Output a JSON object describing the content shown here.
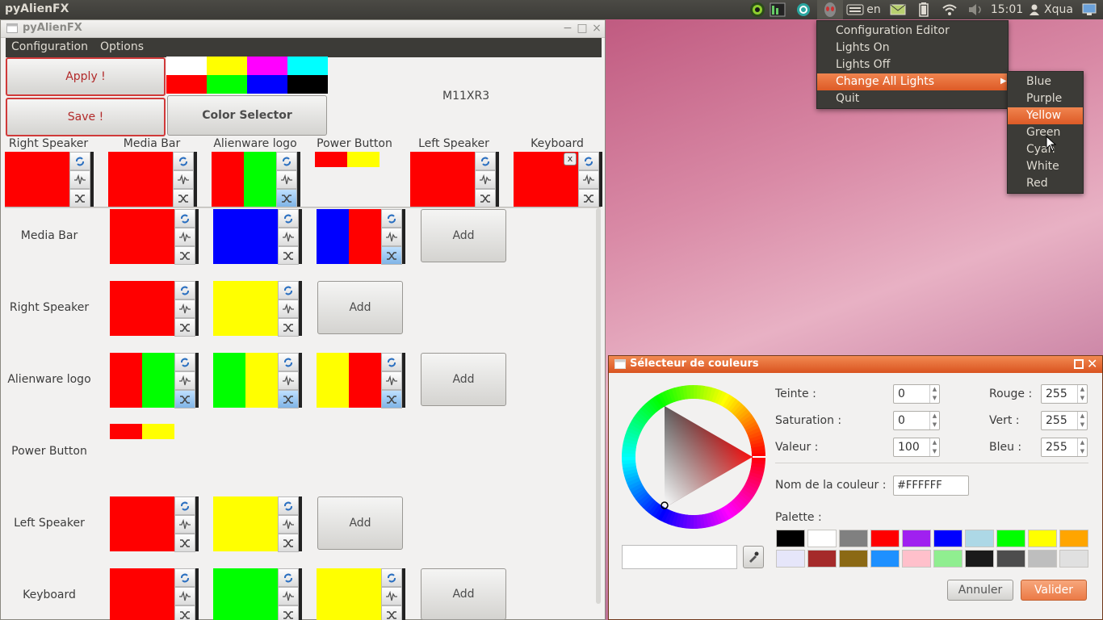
{
  "panel": {
    "app_name": "pyAlienFX",
    "lang": "en",
    "clock": "15:01",
    "user": "Xqua"
  },
  "main_window": {
    "title": "pyAlienFX",
    "menu": [
      "Configuration",
      "Options"
    ],
    "apply_label": "Apply !",
    "save_label": "Save !",
    "color_selector_label": "Color Selector",
    "model": "M11XR3",
    "quick_colors_top": [
      "#ffffff",
      "#ffff00",
      "#ff00ff",
      "#00ffff"
    ],
    "quick_colors_bottom": [
      "#ff0000",
      "#00ff00",
      "#0000ff",
      "#000000"
    ],
    "zone_headers": [
      "Right Speaker",
      "Media Bar",
      "Alienware logo",
      "Power Button",
      "Left Speaker",
      "Keyboard"
    ],
    "row_labels": [
      "Media Bar",
      "Right Speaker",
      "Alienware logo",
      "Power Button",
      "Left Speaker",
      "Keyboard"
    ],
    "add_label": "Add",
    "close_x": "x"
  },
  "tray_menu": {
    "items": [
      "Configuration Editor",
      "Lights On",
      "Lights Off",
      "Change All Lights",
      "Quit"
    ],
    "active_index": 3
  },
  "submenu": {
    "items": [
      "Blue",
      "Purple",
      "Yellow",
      "Green",
      "Cyan",
      "White",
      "Red"
    ],
    "active_index": 2
  },
  "color_dialog": {
    "title": "Sélecteur de couleurs",
    "hue_label": "Teinte :",
    "hue_value": "0",
    "sat_label": "Saturation :",
    "sat_value": "0",
    "val_label": "Valeur :",
    "val_value": "100",
    "red_label": "Rouge :",
    "red_value": "255",
    "green_label": "Vert :",
    "green_value": "255",
    "blue_label": "Bleu :",
    "blue_value": "255",
    "name_label": "Nom de la couleur :",
    "name_value": "#FFFFFF",
    "palette_label": "Palette :",
    "palette_row1": [
      "#000000",
      "#ffffff",
      "#808080",
      "#ff0000",
      "#a020f0",
      "#0000ff",
      "#add8e6",
      "#00ff00",
      "#ffff00",
      "#ffa500"
    ],
    "palette_row2": [
      "#e6e6fa",
      "#a52a2a",
      "#8b6914",
      "#1e90ff",
      "#ffc0cb",
      "#90ee90",
      "#1a1a1a",
      "#4d4d4d",
      "#bebebe",
      "#e0e0e0"
    ],
    "cancel_label": "Annuler",
    "ok_label": "Valider"
  }
}
